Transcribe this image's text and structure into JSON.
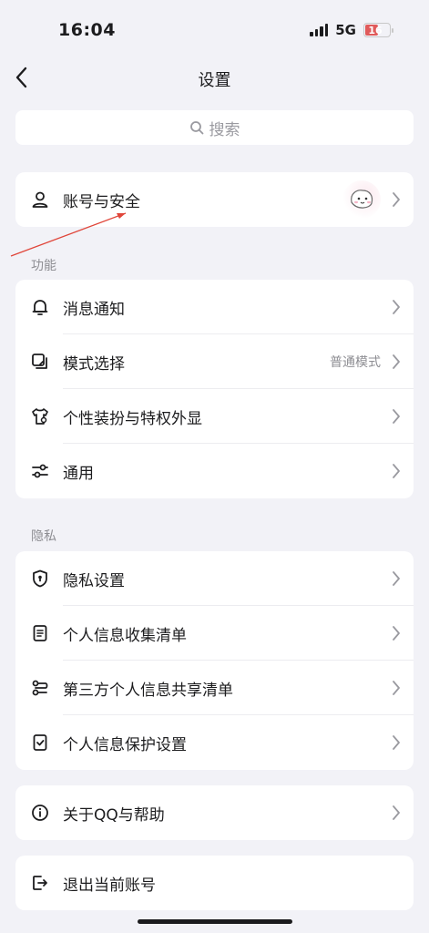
{
  "status_bar": {
    "time": "16:04",
    "network": "5G",
    "battery": "16"
  },
  "nav": {
    "title": "设置"
  },
  "search": {
    "placeholder": "搜索"
  },
  "account": {
    "label": "账号与安全"
  },
  "sections": {
    "features": {
      "title": "功能",
      "items": [
        {
          "label": "消息通知",
          "icon": "bell-icon"
        },
        {
          "label": "模式选择",
          "value": "普通模式",
          "icon": "mode-icon"
        },
        {
          "label": "个性装扮与特权外显",
          "icon": "tshirt-icon"
        },
        {
          "label": "通用",
          "icon": "sliders-icon"
        }
      ]
    },
    "privacy": {
      "title": "隐私",
      "items": [
        {
          "label": "隐私设置",
          "icon": "shield-icon"
        },
        {
          "label": "个人信息收集清单",
          "icon": "document-icon"
        },
        {
          "label": "第三方个人信息共享清单",
          "icon": "share-icon"
        },
        {
          "label": "个人信息保护设置",
          "icon": "checklist-icon"
        }
      ]
    }
  },
  "about": {
    "label": "关于QQ与帮助"
  },
  "logout": {
    "label": "退出当前账号"
  },
  "colors": {
    "background": "#f2f2f7",
    "card": "#ffffff",
    "annotation": "#e0463a"
  }
}
